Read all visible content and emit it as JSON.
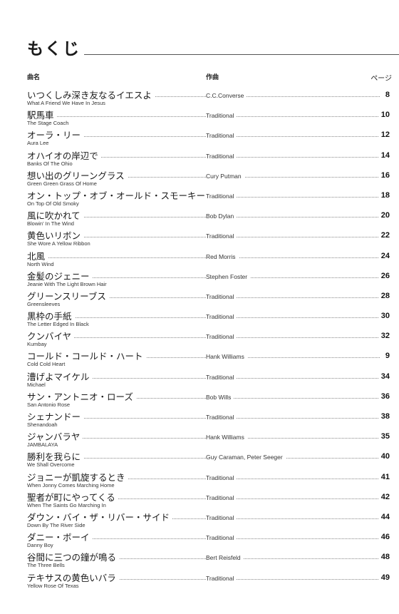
{
  "page_title": "もくじ",
  "headers": {
    "song": "曲名",
    "composer": "作曲",
    "page": "ページ"
  },
  "entries": [
    {
      "jp": "いつくしみ深き友なるイエスよ",
      "en": "What A Friend We Have In Jesus",
      "composer": "C.C.Converse",
      "page": "8"
    },
    {
      "jp": "駅馬車",
      "en": "The Stage Coach",
      "composer": "Traditional",
      "page": "10"
    },
    {
      "jp": "オーラ・リー",
      "en": "Aura Lee",
      "composer": "Traditional",
      "page": "12"
    },
    {
      "jp": "オハイオの岸辺で",
      "en": "Banks Of The Ohio",
      "composer": "Traditional",
      "page": "14"
    },
    {
      "jp": "想い出のグリーングラス",
      "en": "Green Green Grass Of Home",
      "composer": "Cury Putman",
      "page": "16"
    },
    {
      "jp": "オン・トップ・オブ・オールド・スモーキー",
      "en": "On Top Of Old Smoky",
      "composer": "Traditional",
      "page": "18"
    },
    {
      "jp": "風に吹かれて",
      "en": "Blowin' In The Wind",
      "composer": "Bob Dylan",
      "page": "20"
    },
    {
      "jp": "黄色いリボン",
      "en": "She Wore A Yellow Ribbon",
      "composer": "Traditional",
      "page": "22"
    },
    {
      "jp": "北風",
      "en": "North Wind",
      "composer": "Red Morris",
      "page": "24"
    },
    {
      "jp": "金髪のジェニー",
      "en": "Jeanie With The Light Brown Hair",
      "composer": "Stephen Foster",
      "page": "26"
    },
    {
      "jp": "グリーンスリーブス",
      "en": "Greensleeves",
      "composer": "Traditional",
      "page": "28"
    },
    {
      "jp": "黒枠の手紙",
      "en": "The Letter Edged In Black",
      "composer": "Traditional",
      "page": "30"
    },
    {
      "jp": "クンバイヤ",
      "en": "Kumbay",
      "composer": "Traditional",
      "page": "32"
    },
    {
      "jp": "コールド・コールド・ハート",
      "en": "Cold Cold Heart",
      "composer": "Hank Williams",
      "page": "9"
    },
    {
      "jp": "漕げよマイケル",
      "en": "Michael",
      "composer": "Traditional",
      "page": "34"
    },
    {
      "jp": "サン・アントニオ・ローズ",
      "en": "San Antonio Rose",
      "composer": "Bob Wills",
      "page": "36"
    },
    {
      "jp": "シェナンドー",
      "en": "Shenandoah",
      "composer": "Traditional",
      "page": "38"
    },
    {
      "jp": "ジャンバラヤ",
      "en": "JAMBALAYA",
      "composer": "Hank Williams",
      "page": "35"
    },
    {
      "jp": "勝利を我らに",
      "en": "We Shall Overcome",
      "composer": "Guy Caraman, Peter Seeger",
      "page": "40"
    },
    {
      "jp": "ジョニーが凱旋するとき",
      "en": "When Jonny Comes Marching Home",
      "composer": "Traditional",
      "page": "41"
    },
    {
      "jp": "聖者が町にやってくる",
      "en": "When The Saints Go Marching In",
      "composer": "Traditional",
      "page": "42"
    },
    {
      "jp": "ダウン・バイ・ザ・リバー・サイド",
      "en": "Down By The River Side",
      "composer": "Traditional",
      "page": "44"
    },
    {
      "jp": "ダニー・ボーイ",
      "en": "Danny Boy",
      "composer": "Traditional",
      "page": "46"
    },
    {
      "jp": "谷間に三つの鐘が鳴る",
      "en": "The Three Bells",
      "composer": "Bert Reisfeld",
      "page": "48"
    },
    {
      "jp": "テキサスの黄色いバラ",
      "en": "Yellow Rose Of Texas",
      "composer": "Traditional",
      "page": "49"
    }
  ]
}
